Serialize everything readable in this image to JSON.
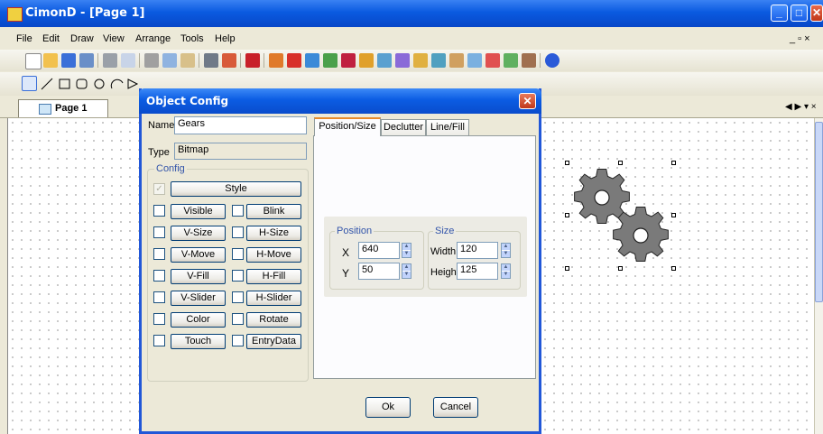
{
  "app": {
    "title": "CimonD - [Page 1]"
  },
  "menu": [
    "File",
    "Edit",
    "Draw",
    "View",
    "Arrange",
    "Tools",
    "Help"
  ],
  "document_tab": {
    "label": "Page 1",
    "nav": "◀ ▶ ▾ ×"
  },
  "dialog": {
    "title": "Object Config",
    "close_glyph": "✕",
    "name_label": "Name",
    "name_value": "Gears",
    "type_label": "Type",
    "type_value": "Bitmap",
    "config_label": "Config",
    "style_label": "Style",
    "config_buttons": [
      {
        "left": "Visible",
        "right": "Blink"
      },
      {
        "left": "V-Size",
        "right": "H-Size"
      },
      {
        "left": "V-Move",
        "right": "H-Move"
      },
      {
        "left": "V-Fill",
        "right": "H-Fill"
      },
      {
        "left": "V-Slider",
        "right": "H-Slider"
      },
      {
        "left": "Color",
        "right": "Rotate"
      },
      {
        "left": "Touch",
        "right": "EntryData"
      }
    ],
    "tabs": [
      "Position/Size",
      "Declutter",
      "Line/Fill"
    ],
    "position": {
      "label": "Position",
      "x_label": "X",
      "x_value": "640",
      "y_label": "Y",
      "y_value": "50"
    },
    "size": {
      "label": "Size",
      "width_label": "Width",
      "width_value": "120",
      "height_label": "Height",
      "height_value": "125"
    },
    "ok_label": "Ok",
    "cancel_label": "Cancel"
  },
  "colors": {
    "titlebar": "#0a5ae0",
    "gear": "#7a7a7a",
    "accent_tab": "#e68b2c"
  }
}
